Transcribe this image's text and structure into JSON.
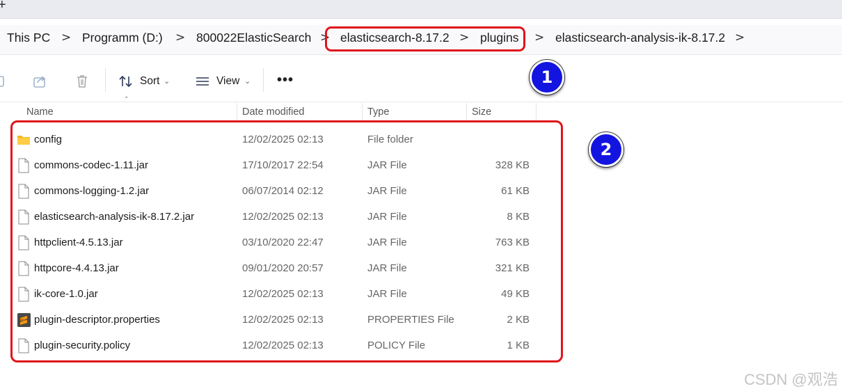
{
  "breadcrumb": {
    "items": [
      {
        "label": "This PC"
      },
      {
        "label": "Programm (D:)"
      },
      {
        "label": "800022ElasticSearch"
      },
      {
        "label": "elasticsearch-8.17.2"
      },
      {
        "label": "plugins"
      },
      {
        "label": "elasticsearch-analysis-ik-8.17.2"
      }
    ],
    "separator": ">"
  },
  "toolbar": {
    "sort_label": "Sort",
    "view_label": "View",
    "more_label": "•••",
    "icons": [
      "copy-icon",
      "share-icon",
      "delete-icon",
      "sort-icon",
      "view-icon",
      "more-icon"
    ]
  },
  "columns": {
    "name": "Name",
    "date": "Date modified",
    "type": "Type",
    "size": "Size"
  },
  "files": [
    {
      "name": "config",
      "date": "12/02/2025 02:13",
      "type": "File folder",
      "size": "",
      "icon": "folder-icon"
    },
    {
      "name": "commons-codec-1.11.jar",
      "date": "17/10/2017 22:54",
      "type": "JAR File",
      "size": "328 KB",
      "icon": "file-icon"
    },
    {
      "name": "commons-logging-1.2.jar",
      "date": "06/07/2014 02:12",
      "type": "JAR File",
      "size": "61 KB",
      "icon": "file-icon"
    },
    {
      "name": "elasticsearch-analysis-ik-8.17.2.jar",
      "date": "12/02/2025 02:13",
      "type": "JAR File",
      "size": "8 KB",
      "icon": "file-icon"
    },
    {
      "name": "httpclient-4.5.13.jar",
      "date": "03/10/2020 22:47",
      "type": "JAR File",
      "size": "763 KB",
      "icon": "file-icon"
    },
    {
      "name": "httpcore-4.4.13.jar",
      "date": "09/01/2020 20:57",
      "type": "JAR File",
      "size": "321 KB",
      "icon": "file-icon"
    },
    {
      "name": "ik-core-1.0.jar",
      "date": "12/02/2025 02:13",
      "type": "JAR File",
      "size": "49 KB",
      "icon": "file-icon"
    },
    {
      "name": "plugin-descriptor.properties",
      "date": "12/02/2025 02:13",
      "type": "PROPERTIES File",
      "size": "2 KB",
      "icon": "sublime-file-icon"
    },
    {
      "name": "plugin-security.policy",
      "date": "12/02/2025 02:13",
      "type": "POLICY File",
      "size": "1 KB",
      "icon": "file-icon"
    }
  ],
  "annotations": {
    "badge1": "1",
    "badge2": "2",
    "highlight_color": "#e0141b",
    "badge_color": "#1414e0"
  },
  "watermark": "CSDN @观浩"
}
